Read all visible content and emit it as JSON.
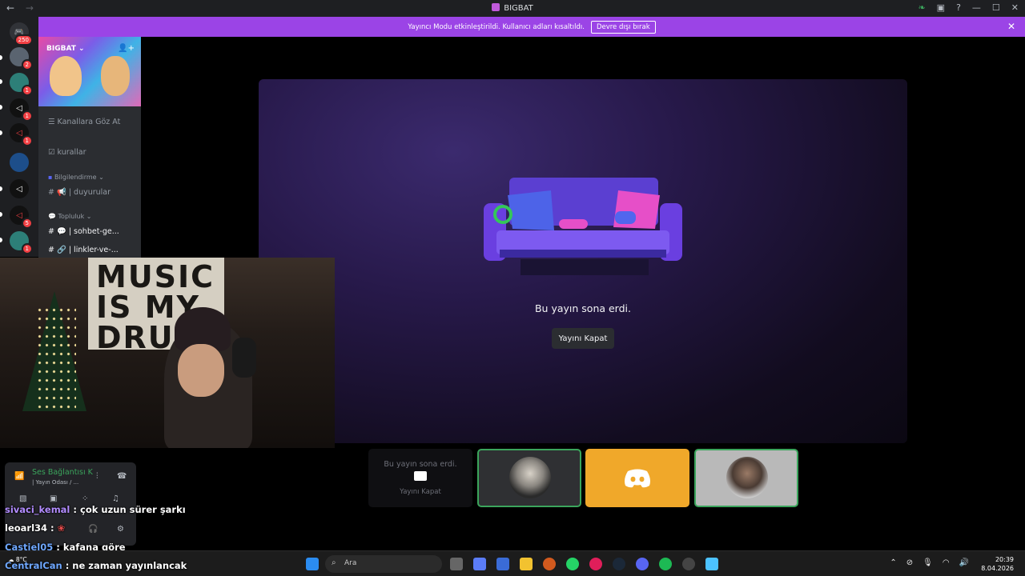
{
  "window": {
    "title": "BIGBAT",
    "back": "←",
    "forward": "→",
    "min": "—",
    "max": "☐",
    "close": "✕"
  },
  "banner": {
    "text": "Yayıncı Modu etkinleştirildi. Kullanıcı adları kısaltıldı.",
    "button": "Devre dışı bırak"
  },
  "servers": [
    {
      "badge": "250"
    },
    {
      "badge": "2"
    },
    {
      "badge": "1"
    },
    {
      "badge": "1"
    },
    {
      "badge": "1"
    },
    {
      "badge": ""
    },
    {
      "badge": ""
    },
    {
      "badge": "5"
    },
    {
      "badge": "1"
    }
  ],
  "server": {
    "name": "BIGBAT ⌄"
  },
  "channels": {
    "browse": "Kanallara Göz At",
    "rules": "kurallar",
    "cat_info": "Bilgilendirme ⌄",
    "announcements": "| duyurular",
    "cat_community": "Topluluk ⌄",
    "chat": "| sohbet-ge...",
    "links": "| linkler-ve-..."
  },
  "stage": {
    "ended_text": "Bu yayın sona erdi.",
    "close_button": "Yayını Kapat"
  },
  "tiles": [
    {
      "ended": "Bu yayın sona erdi.",
      "close": "Yayını Kapat"
    }
  ],
  "voice": {
    "status": "Ses Bağlantısı K",
    "channel": "| Yayın Odası / ..."
  },
  "chat_overlay": [
    {
      "user": "sivaci_kemal",
      "msg": ": çok uzun sürer şarkı",
      "color": "#b28cff"
    },
    {
      "user": "leoarl34",
      "msg": ":",
      "color": "#ffffff"
    },
    {
      "user": "Castiel05",
      "msg": ": kafana göre",
      "color": "#6fa8ff"
    },
    {
      "user": "CentralCan",
      "msg": ": ne zaman yayınlancak",
      "color": "#6fa8ff"
    }
  ],
  "taskbar": {
    "search_placeholder": "Ara",
    "weather": "8°C",
    "time": "20:39",
    "date": "8.04.2026"
  }
}
